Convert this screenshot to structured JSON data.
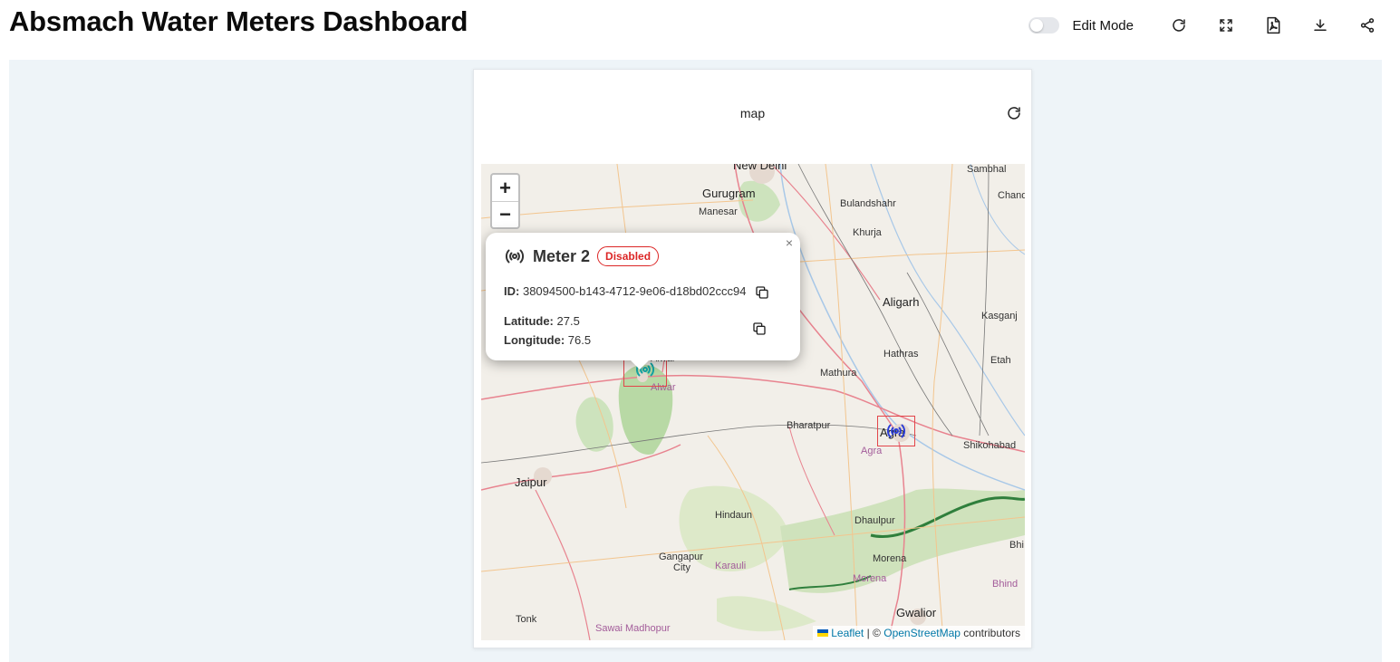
{
  "header": {
    "title": "Absmach Water Meters Dashboard",
    "edit_mode_label": "Edit Mode",
    "icons": [
      "refresh-icon",
      "fullscreen-icon",
      "pdf-icon",
      "download-icon",
      "share-icon"
    ]
  },
  "widget": {
    "title": "map"
  },
  "map": {
    "zoom_in": "+",
    "zoom_out": "−",
    "places": [
      {
        "name": "New Delhi",
        "cls": "big"
      },
      {
        "name": "Gurugram",
        "cls": "big"
      },
      {
        "name": "Manesar",
        "cls": ""
      },
      {
        "name": "Sambhal",
        "cls": ""
      },
      {
        "name": "Chand",
        "cls": ""
      },
      {
        "name": "Bulandshahr",
        "cls": ""
      },
      {
        "name": "Khurja",
        "cls": ""
      },
      {
        "name": "Aligarh",
        "cls": "big"
      },
      {
        "name": "Kasganj",
        "cls": ""
      },
      {
        "name": "Hathras",
        "cls": ""
      },
      {
        "name": "Etah",
        "cls": ""
      },
      {
        "name": "Mathura",
        "cls": ""
      },
      {
        "name": "Alwar",
        "cls": ""
      },
      {
        "name": "Alwar",
        "cls": "purple"
      },
      {
        "name": "Bharatpur",
        "cls": ""
      },
      {
        "name": "Agra",
        "cls": "big"
      },
      {
        "name": "Agra",
        "cls": "purple"
      },
      {
        "name": "Shikohabad",
        "cls": ""
      },
      {
        "name": "Jaipur",
        "cls": "big"
      },
      {
        "name": "Hindaun",
        "cls": ""
      },
      {
        "name": "Dhaulpur",
        "cls": ""
      },
      {
        "name": "Bhi",
        "cls": ""
      },
      {
        "name": "Gangapur",
        "cls": ""
      },
      {
        "name": "City",
        "cls": ""
      },
      {
        "name": "Karauli",
        "cls": "purple"
      },
      {
        "name": "Morena",
        "cls": ""
      },
      {
        "name": "Morena",
        "cls": "purple"
      },
      {
        "name": "Bhind",
        "cls": "purple"
      },
      {
        "name": "Tonk",
        "cls": ""
      },
      {
        "name": "Gwalior",
        "cls": "big"
      },
      {
        "name": "Sawai Madhopur",
        "cls": "purple"
      }
    ],
    "attribution": {
      "leaflet": "Leaflet",
      "sep": "| ©",
      "osm": "OpenStreetMap",
      "suffix": "contributors"
    }
  },
  "popup": {
    "close": "×",
    "name": "Meter 2",
    "status": "Disabled",
    "id_label": "ID:",
    "id_value": "38094500-b143-4712-9e06-d18bd02ccc94",
    "lat_label": "Latitude:",
    "lat_value": "27.5",
    "lon_label": "Longitude:",
    "lon_value": "76.5",
    "status_color": "#dc2626"
  },
  "markers": [
    {
      "name": "Meter 2",
      "color": "#14a5a5"
    },
    {
      "name": "meter-agra",
      "color": "#2d3ed6"
    }
  ]
}
